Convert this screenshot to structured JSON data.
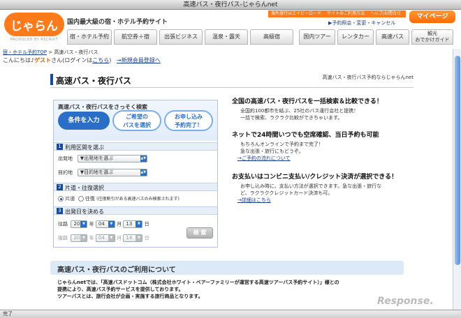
{
  "window": {
    "title": "高速バス・夜行バス-じゃらんnet"
  },
  "header": {
    "logo_text": "じゃらん",
    "logo_sub": "PRODUCED BY RECRUIT",
    "tagline": "国内最大級の宿・ホテル予約サイト",
    "top_links": [
      "海外旅行はエイビーロード",
      "サイトのご利用方法",
      "ヘルプ/お問合せ"
    ],
    "mypage_label": "マイページ",
    "reserve_link": "予約照会・変更・キャンセル"
  },
  "nav": {
    "items": [
      {
        "label": "宿・ホテル予約"
      },
      {
        "label": "航空券＋宿"
      },
      {
        "label": "出張ビジネス"
      },
      {
        "label": "温泉・露天"
      },
      {
        "label": "高級宿"
      },
      {
        "label": "国内ツアー"
      },
      {
        "label": "レンタカー"
      },
      {
        "label": "高速バス"
      },
      {
        "label": "観光\nおでかけガイド"
      }
    ]
  },
  "breadcrumb": {
    "home": "宿・ホテル予約TOP",
    "sep": " > ",
    "current": "高速バス・夜行バス"
  },
  "greeting": {
    "prefix": "こんにちは♪",
    "guest": "ゲスト",
    "mid": "さん(ログインは",
    "login": "こちら",
    "close": ")",
    "register": "→新規会員登録へ"
  },
  "page": {
    "title": "高速バス・夜行バス",
    "note": "高速バス・夜行バス予約ならじゃらんnet"
  },
  "search": {
    "steps_title": "高速バス・夜行バスをさっそく検索",
    "step1": "条件を入力",
    "step2": "ご希望の\nバスを選択",
    "step3": "お申し込み\n予約完了！",
    "sec1": {
      "num": "1",
      "label": "利用区間を選ぶ"
    },
    "from_label": "出発地",
    "from_value": "▼出発地を選ぶ",
    "to_label": "目的地",
    "to_value": "▼目的地を選ぶ",
    "sec2": {
      "num": "2",
      "label": "片道・往復選択"
    },
    "oneway_label": "片道",
    "roundtrip_label": "往復",
    "roundtrip_note": "(往復割引がある高速バスのみ検索されます)",
    "sec3": {
      "num": "3",
      "label": "出発日を決める"
    },
    "outbound_label": "往路",
    "return_label": "復路",
    "year_value": "20",
    "year_unit": "年",
    "month_value": "04",
    "month_unit": "月",
    "day_value": "13",
    "day_value_return": "14",
    "day_unit": "日",
    "search_button": "検 索"
  },
  "features": [
    {
      "title": "全国の高速バス・夜行バスを一括検索＆比較できる！",
      "lines": [
        "全国約100都市を結ぶ、25社のバス運行会社と提携！",
        "一括で検索、ラクラク比較ができちゃいます。"
      ],
      "link": ""
    },
    {
      "title": "ネットで24時間いつでも空席確認、当日予約も可能",
      "lines": [
        "もちろんオンラインで予約まで完了！",
        "急な出張・旅行にもどうぞ。"
      ],
      "link": "→ご予約の流れについて"
    },
    {
      "title": "お支払いはコンビニ支払い/クレジット決済が選択できる！",
      "lines": [
        "お申し込み時に、支払い方法が選択できます。急な出張・旅行な",
        "ど、ラクラククレジットカード決済も可。"
      ],
      "link": "→詳細はこちら"
    }
  ],
  "usage": {
    "title": "高速バス・夜行バスのご利用について",
    "lines": [
      "じゃらんnetでは、「高速バスドットコム（株式会社ホワイト・ベアーファミリーが運営する高速ツアーバス予約サイト）」様との",
      "提携により、高速バス予約サービスを提供しております。",
      "ツアーバスとは、旅行会社が企画・実施する旅行商品となります。"
    ]
  },
  "status": {
    "text": "完了"
  },
  "watermark": "Response."
}
